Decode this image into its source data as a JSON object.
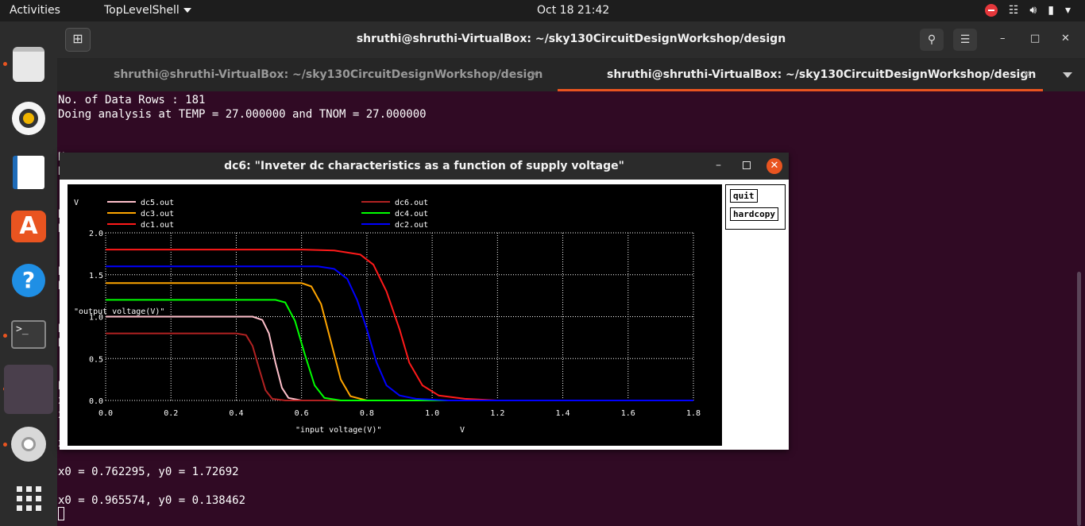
{
  "topbar": {
    "activities": "Activities",
    "app_menu": "TopLevelShell",
    "clock": "Oct 18  21:42"
  },
  "dock": [
    "files-icon",
    "rhythmbox-icon",
    "writer-icon",
    "software-store-icon",
    "help-icon",
    "terminal-icon",
    "active-app-icon",
    "disc-icon",
    "show-apps-icon"
  ],
  "terminal": {
    "title": "shruthi@shruthi-VirtualBox: ~/sky130CircuitDesignWorkshop/design",
    "tabs": [
      {
        "label": "shruthi@shruthi-VirtualBox: ~/sky130CircuitDesignWorkshop/design",
        "active": false
      },
      {
        "label": "shruthi@shruthi-VirtualBox: ~/sky130CircuitDesignWorkshop/design",
        "active": true
      }
    ],
    "lines": {
      "l1": "No. of Data Rows : 181",
      "l2": "Doing analysis at TEMP = 27.000000 and TNOM = 27.000000",
      "l3": "x0 = 0.762295, y0 = 1.72692",
      "l4": "x0 = 0.965574, y0 = 0.138462"
    },
    "hidden_left_chars": [
      "N",
      "D",
      "N",
      "D",
      "N",
      "D",
      "N",
      "D",
      "N",
      "x",
      "x",
      "x"
    ]
  },
  "plot_window": {
    "title": "dc6: \"Inveter dc characteristics as a function of supply voltage\"",
    "quit_label": "quit",
    "hardcopy_label": "hardcopy"
  },
  "chart_data": {
    "type": "line",
    "title": "",
    "xlabel": "\"input voltage(V)\"",
    "xunit": "V",
    "ylabel": "\"output voltage(V)\"",
    "yunit": "V",
    "xlim": [
      0,
      1.8
    ],
    "ylim": [
      0,
      2.0
    ],
    "xticks": [
      "0.0",
      "0.2",
      "0.4",
      "0.6",
      "0.8",
      "1.0",
      "1.2",
      "1.4",
      "1.6",
      "1.8"
    ],
    "yticks": [
      "0.0",
      "0.5",
      "1.0",
      "1.5",
      "2.0"
    ],
    "grid": true,
    "legend_placement": "top",
    "series": [
      {
        "name": "dc5.out",
        "color": "#ffc0cb",
        "x": [
          0,
          0.45,
          0.48,
          0.5,
          0.52,
          0.54,
          0.56,
          0.6,
          1.8
        ],
        "y": [
          1.0,
          1.0,
          0.96,
          0.8,
          0.45,
          0.15,
          0.03,
          0.0,
          0.0
        ]
      },
      {
        "name": "dc3.out",
        "color": "#ffa500",
        "x": [
          0,
          0.6,
          0.63,
          0.66,
          0.69,
          0.72,
          0.75,
          0.8,
          1.8
        ],
        "y": [
          1.4,
          1.4,
          1.36,
          1.15,
          0.7,
          0.25,
          0.05,
          0.0,
          0.0
        ]
      },
      {
        "name": "dc1.out",
        "color": "#ff1a1a",
        "x": [
          0,
          0.6,
          0.7,
          0.78,
          0.82,
          0.86,
          0.9,
          0.93,
          0.97,
          1.02,
          1.1,
          1.2,
          1.8
        ],
        "y": [
          1.8,
          1.8,
          1.79,
          1.74,
          1.62,
          1.3,
          0.85,
          0.45,
          0.18,
          0.06,
          0.02,
          0.0,
          0.0
        ]
      },
      {
        "name": "dc6.out",
        "color": "#b22222",
        "x": [
          0,
          0.4,
          0.43,
          0.45,
          0.47,
          0.49,
          0.51,
          0.55,
          1.8
        ],
        "y": [
          0.8,
          0.8,
          0.78,
          0.65,
          0.38,
          0.12,
          0.02,
          0.0,
          0.0
        ]
      },
      {
        "name": "dc4.out",
        "color": "#00ff00",
        "x": [
          0,
          0.52,
          0.55,
          0.58,
          0.61,
          0.64,
          0.67,
          0.72,
          1.8
        ],
        "y": [
          1.2,
          1.2,
          1.17,
          0.95,
          0.55,
          0.18,
          0.03,
          0.0,
          0.0
        ]
      },
      {
        "name": "dc2.out",
        "color": "#0000ff",
        "x": [
          0,
          0.65,
          0.7,
          0.74,
          0.77,
          0.8,
          0.83,
          0.86,
          0.9,
          0.95,
          1.05,
          1.8
        ],
        "y": [
          1.6,
          1.6,
          1.57,
          1.45,
          1.2,
          0.85,
          0.45,
          0.18,
          0.06,
          0.02,
          0.0,
          0.0
        ]
      }
    ]
  }
}
